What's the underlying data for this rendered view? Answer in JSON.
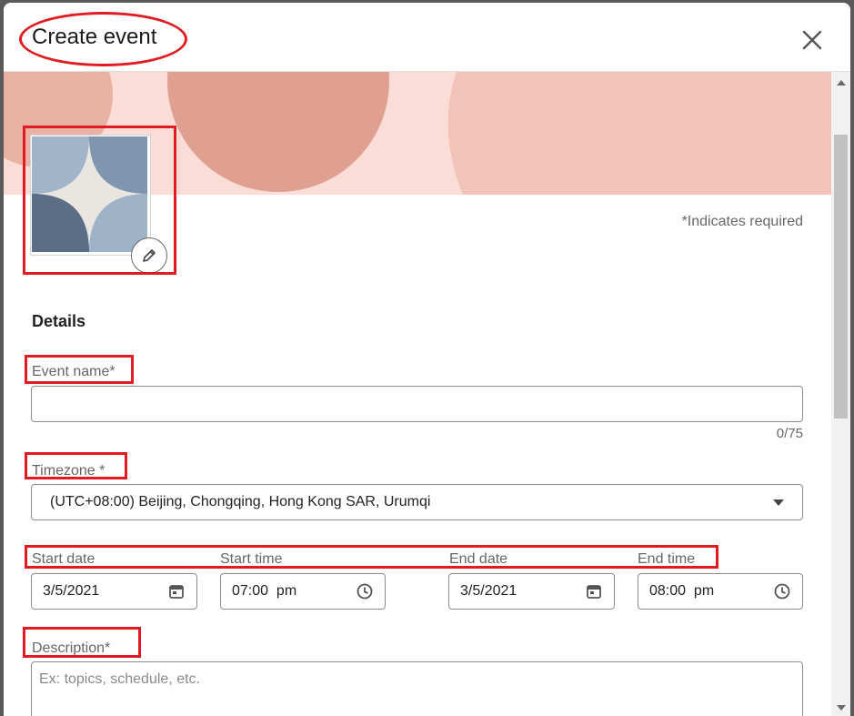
{
  "dialog": {
    "title": "Create event",
    "close_label": "Close"
  },
  "form": {
    "required_note": "*Indicates required",
    "details_heading": "Details",
    "event_name": {
      "label": "Event name*",
      "value": "",
      "counter": "0/75"
    },
    "timezone": {
      "label": "Timezone *",
      "selected": "(UTC+08:00) Beijing, Chongqing, Hong Kong SAR, Urumqi"
    },
    "start_date": {
      "label": "Start date",
      "value": "3/5/2021"
    },
    "start_time": {
      "label": "Start time",
      "value": "07:00  pm"
    },
    "end_date": {
      "label": "End date",
      "value": "3/5/2021"
    },
    "end_time": {
      "label": "End time",
      "value": "08:00  pm"
    },
    "description": {
      "label": "Description*",
      "placeholder": "Ex: topics, schedule, etc."
    }
  },
  "icons": {
    "close": "close-icon",
    "edit": "pencil-icon",
    "calendar": "calendar-icon",
    "clock": "clock-icon",
    "dropdown": "chevron-down-icon"
  },
  "colors": {
    "banner_bg": "#f9ddd6",
    "banner_circle": "#e0a091",
    "banner_shape": "#f2c3b8",
    "annotation": "#e11b22"
  }
}
